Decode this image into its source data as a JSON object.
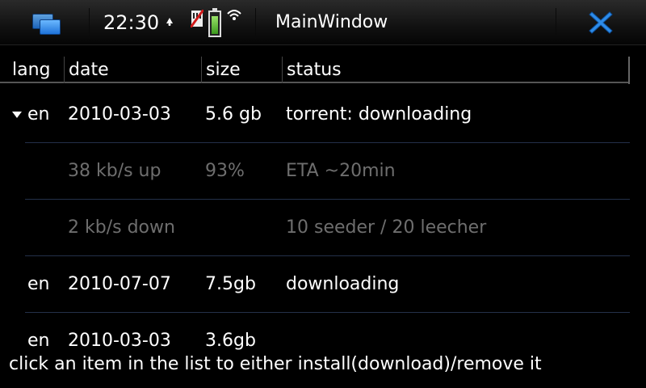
{
  "statusbar": {
    "clock": "22:30",
    "window_title": "MainWindow",
    "battery_level": 0.75,
    "icons": [
      "task-switcher-icon",
      "alarm-icon",
      "sim-icon",
      "battery-icon",
      "wifi-icon",
      "close-icon"
    ]
  },
  "table": {
    "columns": [
      "lang",
      "date",
      "size",
      "status"
    ],
    "rows": [
      {
        "lang": "en",
        "date": "2010-03-03",
        "size": "5.6 gb",
        "status": "torrent: downloading",
        "expanded": true
      },
      {
        "lang": "",
        "date": "38 kb/s up",
        "size": "93%",
        "status": "ETA ~20min",
        "child": true
      },
      {
        "lang": "",
        "date": "2 kb/s down",
        "size": "",
        "status": "10 seeder / 20 leecher",
        "child": true
      },
      {
        "lang": "en",
        "date": "2010-07-07",
        "size": "7.5gb",
        "status": "downloading"
      },
      {
        "lang": "en",
        "date": "2010-03-03",
        "size": "3.6gb",
        "status": ""
      }
    ]
  },
  "footer": {
    "hint": "click an item in the list to either install(download)/remove it"
  },
  "colors": {
    "background": "#000000",
    "text": "#ffffff",
    "child_text": "#6e6e6e",
    "accent_blue": "#1f73d9",
    "battery_green": "#5cc22f"
  }
}
